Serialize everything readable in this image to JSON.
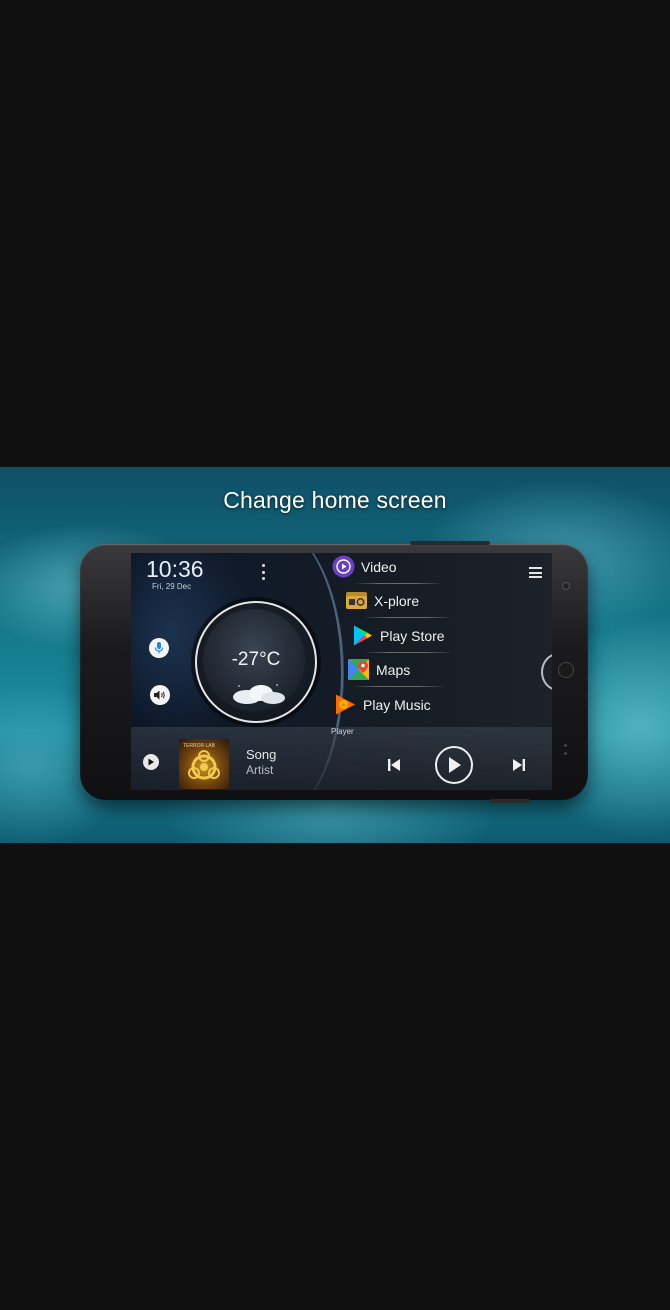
{
  "promo": {
    "title": "Change home screen"
  },
  "clock": {
    "time": "10:36",
    "date": "Fri, 29 Dec"
  },
  "weather": {
    "temperature": "-27°C",
    "condition_icon": "night-cloud-icon"
  },
  "apps": [
    {
      "label": "Video",
      "icon": "video-icon"
    },
    {
      "label": "X-plore",
      "icon": "xplore-icon"
    },
    {
      "label": "Play Store",
      "icon": "play-store-icon"
    },
    {
      "label": "Maps",
      "icon": "maps-icon"
    },
    {
      "label": "Play Music",
      "icon": "play-music-icon"
    }
  ],
  "player": {
    "label": "Player",
    "song": "Song",
    "artist": "Artist",
    "album_text": "TERROR LAB"
  },
  "colors": {
    "accent_blue": "#1e88e5",
    "video_purple": "#6a3fc2",
    "music_orange": "#ff6d00"
  }
}
